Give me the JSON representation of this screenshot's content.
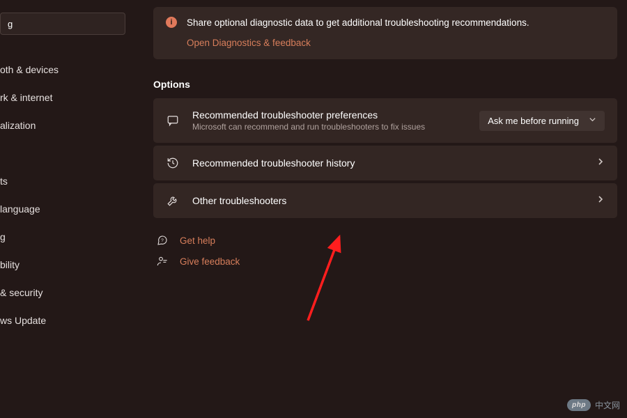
{
  "sidebar": {
    "search": {
      "value": "g"
    },
    "items": [
      {
        "label": "oth & devices"
      },
      {
        "label": "rk & internet"
      },
      {
        "label": "alization"
      },
      {
        "label": ""
      },
      {
        "label": "ts"
      },
      {
        "label": " language"
      },
      {
        "label": "g"
      },
      {
        "label": "bility"
      },
      {
        "label": " & security"
      },
      {
        "label": "ws Update"
      }
    ]
  },
  "notice": {
    "text": "Share optional diagnostic data to get additional troubleshooting recommendations.",
    "link": "Open Diagnostics & feedback"
  },
  "section_title": "Options",
  "cards": {
    "prefs": {
      "title": "Recommended troubleshooter preferences",
      "sub": "Microsoft can recommend and run troubleshooters to fix issues",
      "dropdown": "Ask me before running"
    },
    "history": {
      "title": "Recommended troubleshooter history"
    },
    "other": {
      "title": "Other troubleshooters"
    }
  },
  "footer": {
    "help": "Get help",
    "feedback": "Give feedback"
  },
  "watermark": {
    "badge": "php",
    "text": "中文网"
  }
}
